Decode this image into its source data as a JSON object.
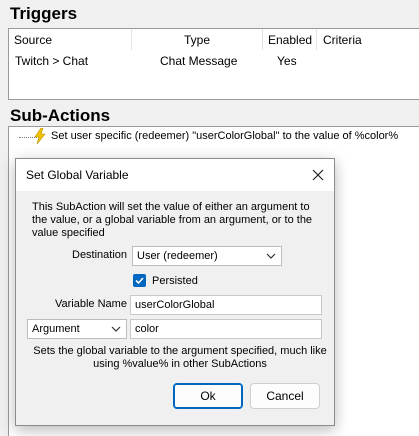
{
  "triggers": {
    "title": "Triggers",
    "columns": [
      "Source",
      "Type",
      "Enabled",
      "Criteria"
    ],
    "rows": [
      {
        "source": "Twitch > Chat",
        "type": "Chat Message",
        "enabled": "Yes",
        "criteria": ""
      }
    ]
  },
  "subactions": {
    "title": "Sub-Actions",
    "items": [
      {
        "text": "Set user specific (redeemer) \"userColorGlobal\" to the value of %color%",
        "icon": "lightning-bolt-icon"
      }
    ]
  },
  "dialog": {
    "title": "Set Global Variable",
    "description": "This SubAction will set the value of either an argument to the value, or a global variable from an argument, or to the value specified",
    "destination_label": "Destination",
    "destination_value": "User (redeemer)",
    "persisted_label": "Persisted",
    "persisted_checked": true,
    "variable_name_label": "Variable Name",
    "variable_name_value": "userColorGlobal",
    "source_mode_value": "Argument",
    "source_value": "color",
    "hint": "Sets the global variable to the argument specified, much like using %value% in other SubActions",
    "ok_label": "Ok",
    "cancel_label": "Cancel"
  },
  "colors": {
    "accent": "#0067c0",
    "bolt": "#f2c200"
  }
}
